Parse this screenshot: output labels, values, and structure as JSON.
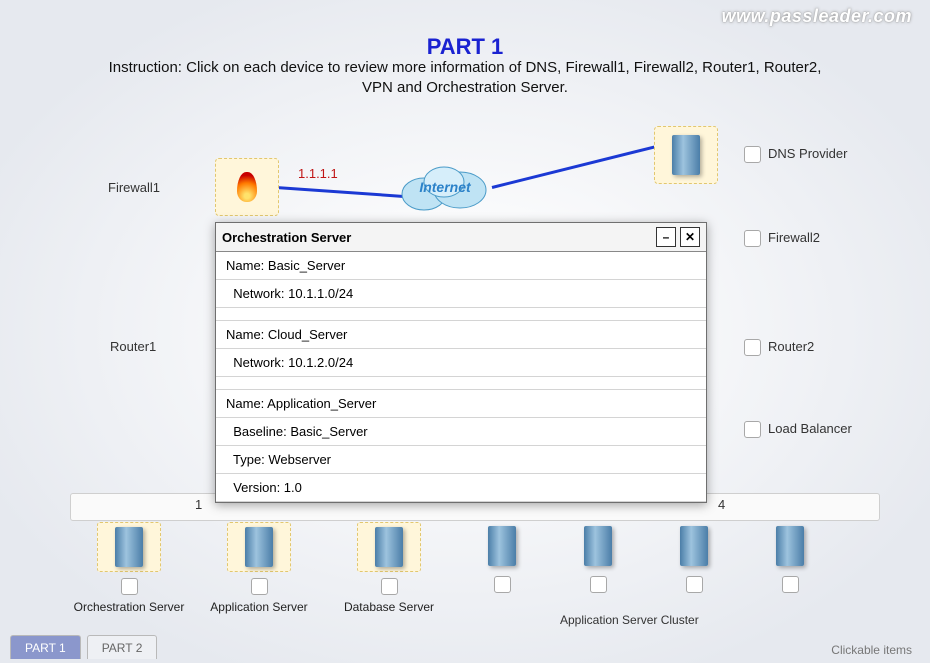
{
  "watermark": "www.passleader.com",
  "title": "PART 1",
  "instruction": "Instruction: Click on each device to review more information of DNS, Firewall1, Firewall2, Router1, Router2, VPN and Orchestration Server.",
  "cloud_label": "Internet",
  "ip_left": "1.1.1.1",
  "labels": {
    "firewall1": "Firewall1",
    "firewall2": "Firewall2",
    "router1": "Router1",
    "router2": "Router2",
    "dns": "DNS Provider",
    "lb": "Load Balancer"
  },
  "bus_right_fragment": "4",
  "bus_left_fragment": "1",
  "bottom": [
    {
      "caption": "Orchestration Server"
    },
    {
      "caption": "Application Server"
    },
    {
      "caption": "Database Server"
    },
    {
      "caption": ""
    },
    {
      "caption": ""
    },
    {
      "caption": ""
    },
    {
      "caption": ""
    }
  ],
  "cluster_caption": "Application Server Cluster",
  "tabs": {
    "part1": "PART 1",
    "part2": "PART 2"
  },
  "clickable_note": "Clickable items",
  "popup": {
    "title": "Orchestration Server",
    "minimize_glyph": "–",
    "close_glyph": "✕",
    "entries": [
      {
        "lines": [
          "Name: Basic_Server",
          "  Network: 10.1.1.0/24"
        ]
      },
      {
        "lines": [
          "Name: Cloud_Server",
          "  Network: 10.1.2.0/24"
        ]
      },
      {
        "lines": [
          "Name: Application_Server",
          "  Baseline: Basic_Server",
          "  Type: Webserver",
          "  Version: 1.0"
        ]
      }
    ]
  }
}
